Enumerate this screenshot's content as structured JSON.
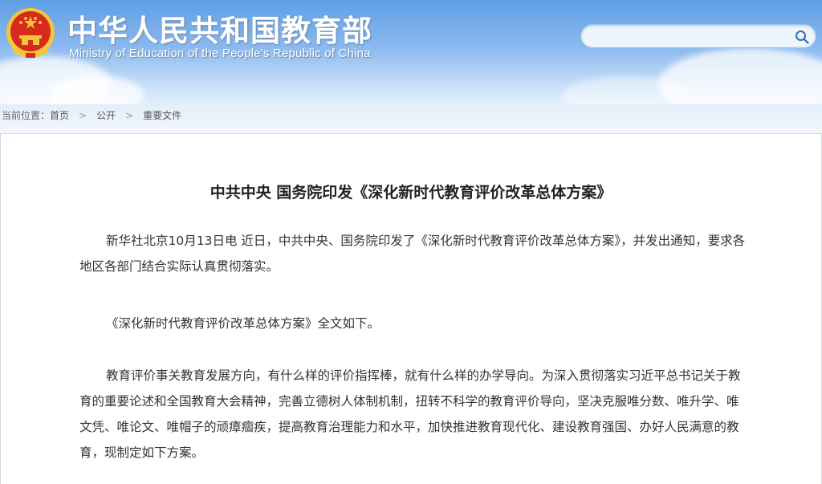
{
  "header": {
    "title_zh": "中华人民共和国教育部",
    "title_en": "Ministry of Education of the People's Republic of China",
    "colors": {
      "sky": "#6aa3e8",
      "emblem_red": "#d42b1e",
      "emblem_gold": "#f3c63a"
    }
  },
  "search": {
    "value": "",
    "placeholder": ""
  },
  "breadcrumb": {
    "prefix": "当前位置：",
    "items": [
      "首页",
      "公开",
      "重要文件"
    ],
    "separator": ">"
  },
  "article": {
    "title": "中共中央 国务院印发《深化新时代教育评价改革总体方案》",
    "paragraphs": [
      "新华社北京10月13日电 近日，中共中央、国务院印发了《深化新时代教育评价改革总体方案》，并发出通知，要求各地区各部门结合实际认真贯彻落实。",
      "《深化新时代教育评价改革总体方案》全文如下。",
      "教育评价事关教育发展方向，有什么样的评价指挥棒，就有什么样的办学导向。为深入贯彻落实习近平总书记关于教育的重要论述和全国教育大会精神，完善立德树人体制机制，扭转不科学的教育评价导向，坚决克服唯分数、唯升学、唯文凭、唯论文、唯帽子的顽瘴痼疾，提高教育治理能力和水平，加快推进教育现代化、建设教育强国、办好人民满意的教育，现制定如下方案。"
    ]
  }
}
